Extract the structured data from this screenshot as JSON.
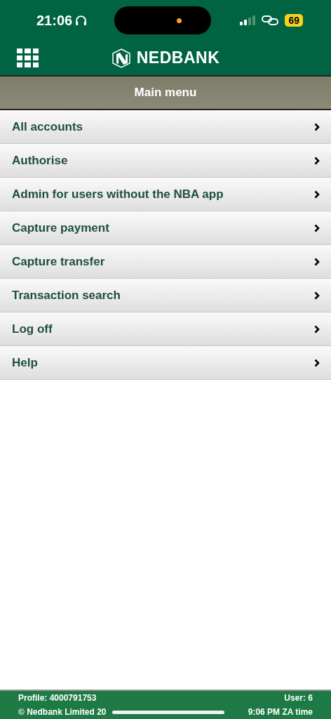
{
  "status_bar": {
    "time": "21:06",
    "battery": "69"
  },
  "header": {
    "brand": "NEDBANK"
  },
  "title": "Main menu",
  "menu": [
    {
      "label": "All accounts"
    },
    {
      "label": "Authorise"
    },
    {
      "label": "Admin for users without the NBA app"
    },
    {
      "label": "Capture payment"
    },
    {
      "label": "Capture transfer"
    },
    {
      "label": "Transaction search"
    },
    {
      "label": "Log off"
    },
    {
      "label": "Help"
    }
  ],
  "footer": {
    "profile": "Profile: 4000791753",
    "user": "User: 6",
    "copyright": "© Nedbank Limited 20",
    "time": "9:06 PM ZA time"
  }
}
